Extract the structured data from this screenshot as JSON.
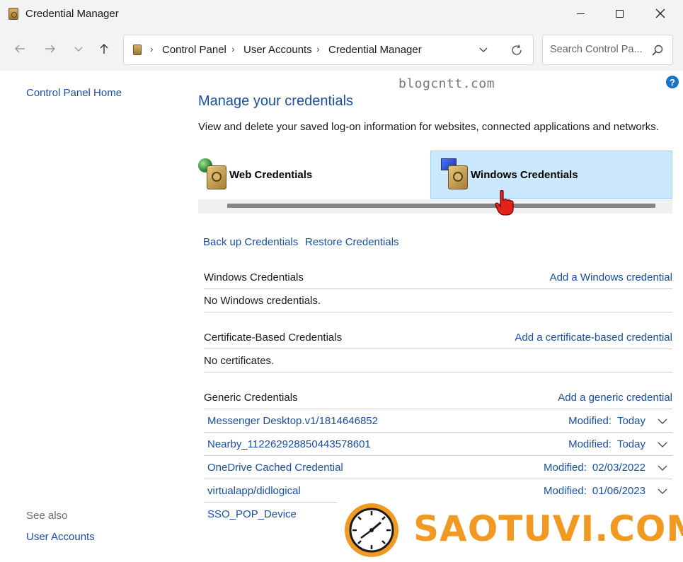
{
  "window": {
    "title": "Credential Manager",
    "icon": "credential-manager-icon"
  },
  "nav": {
    "breadcrumbs": [
      "Control Panel",
      "User Accounts",
      "Credential Manager"
    ],
    "search_placeholder": "Search Control Pa..."
  },
  "left_pane": {
    "home_link": "Control Panel Home",
    "see_also_label": "See also",
    "see_also_links": [
      "User Accounts"
    ]
  },
  "main": {
    "watermark": "blogcntt.com",
    "title": "Manage your credentials",
    "description": "View and delete your saved log-on information for websites, connected applications and networks.",
    "tabs": [
      {
        "label": "Web Credentials",
        "selected": false,
        "icon": "web-credentials-icon"
      },
      {
        "label": "Windows Credentials",
        "selected": true,
        "icon": "windows-credentials-icon"
      }
    ],
    "actions": {
      "backup": "Back up Credentials",
      "restore": "Restore Credentials"
    },
    "sections": {
      "windows": {
        "label": "Windows Credentials",
        "add": "Add a Windows credential",
        "empty": "No Windows credentials."
      },
      "certificate": {
        "label": "Certificate-Based Credentials",
        "add": "Add a certificate-based credential",
        "empty": "No certificates."
      },
      "generic": {
        "label": "Generic Credentials",
        "add": "Add a generic credential",
        "modified_label": "Modified:",
        "items": [
          {
            "name": "Messenger Desktop.v1/1814646852",
            "modified": "Today"
          },
          {
            "name": "Nearby_11226292885044357860​1",
            "modified": "Today"
          },
          {
            "name": "OneDrive Cached Credential",
            "modified": "02/03/2022"
          },
          {
            "name": "virtualapp/didlogical",
            "modified": "01/06/2023"
          },
          {
            "name": "SSO_POP_Device",
            "modified": ""
          }
        ]
      }
    }
  },
  "brand": {
    "text": "SAOTUVI.COM",
    "color": "#f19a23"
  },
  "colors": {
    "link": "#1a4e9e",
    "selected_tab_bg": "#cce8ff",
    "titlebar_bg": "#f3f3f3"
  }
}
